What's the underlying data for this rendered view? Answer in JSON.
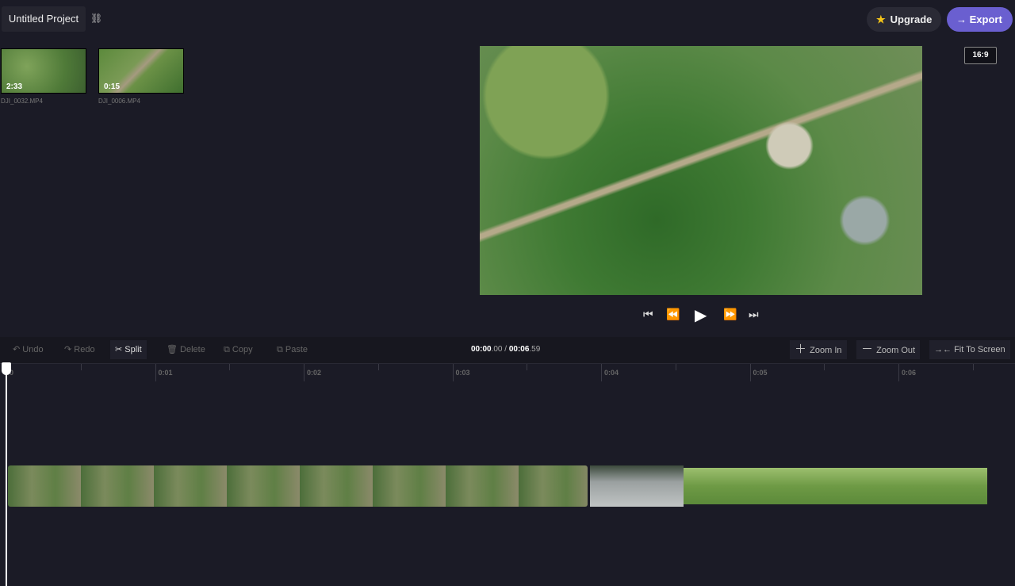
{
  "header": {
    "project_title": "Untitled Project",
    "upgrade_label": "Upgrade",
    "export_label": "Export",
    "aspect_ratio": "16:9"
  },
  "media": [
    {
      "duration": "2:33",
      "filename": "DJI_0032.MP4"
    },
    {
      "duration": "0:15",
      "filename": "DJI_0006.MP4"
    }
  ],
  "toolbar": {
    "undo": "Undo",
    "redo": "Redo",
    "split": "Split",
    "delete": "Delete",
    "copy": "Copy",
    "paste": "Paste",
    "zoom_in": "Zoom In",
    "zoom_out": "Zoom Out",
    "fit": "Fit To Screen"
  },
  "timecode": {
    "current_main": "00:00",
    "current_frac": ".00",
    "sep": " / ",
    "total_main": "00:06",
    "total_frac": ".59"
  },
  "ruler": [
    "0",
    "0:01",
    "0:02",
    "0:03",
    "0:04",
    "0:05",
    "0:06"
  ]
}
